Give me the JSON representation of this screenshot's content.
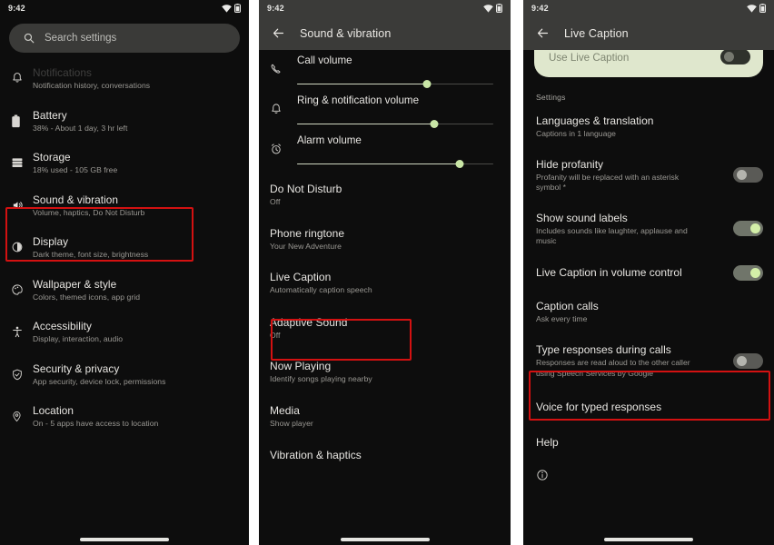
{
  "status_bar": {
    "time": "9:42",
    "wifi_icon": "wifi-icon",
    "battery_icon": "battery-icon"
  },
  "panel1": {
    "search": {
      "placeholder": "Search settings",
      "icon": "search-icon"
    },
    "items": [
      {
        "icon": "bell-icon",
        "title": "Notifications",
        "subtitle": "Notification history, conversations"
      },
      {
        "icon": "battery-icon",
        "title": "Battery",
        "subtitle": "38% - About 1 day, 3 hr left"
      },
      {
        "icon": "storage-icon",
        "title": "Storage",
        "subtitle": "18% used - 105 GB free"
      },
      {
        "icon": "volume-icon",
        "title": "Sound & vibration",
        "subtitle": "Volume, haptics, Do Not Disturb"
      },
      {
        "icon": "brightness-icon",
        "title": "Display",
        "subtitle": "Dark theme, font size, brightness"
      },
      {
        "icon": "palette-icon",
        "title": "Wallpaper & style",
        "subtitle": "Colors, themed icons, app grid"
      },
      {
        "icon": "accessibility-icon",
        "title": "Accessibility",
        "subtitle": "Display, interaction, audio"
      },
      {
        "icon": "shield-icon",
        "title": "Security & privacy",
        "subtitle": "App security, device lock, permissions"
      },
      {
        "icon": "location-pin-icon",
        "title": "Location",
        "subtitle": "On - 5 apps have access to location"
      }
    ]
  },
  "panel2": {
    "appbar": {
      "back_icon": "back-arrow-icon",
      "title": "Sound & vibration"
    },
    "sliders": [
      {
        "icon": "phone-icon",
        "label": "Call volume",
        "value": 66
      },
      {
        "icon": "bell-icon",
        "label": "Ring & notification volume",
        "value": 70
      },
      {
        "icon": "alarm-icon",
        "label": "Alarm volume",
        "value": 83
      }
    ],
    "items": [
      {
        "title": "Do Not Disturb",
        "subtitle": "Off"
      },
      {
        "title": "Phone ringtone",
        "subtitle": "Your New Adventure"
      },
      {
        "title": "Live Caption",
        "subtitle": "Automatically caption speech"
      },
      {
        "title": "Adaptive Sound",
        "subtitle": "Off"
      },
      {
        "title": "Now Playing",
        "subtitle": "Identify songs playing nearby"
      },
      {
        "title": "Media",
        "subtitle": "Show player"
      },
      {
        "title": "Vibration & haptics",
        "subtitle": ""
      }
    ]
  },
  "panel3": {
    "appbar": {
      "back_icon": "back-arrow-icon",
      "title": "Live Caption"
    },
    "use_live_caption": {
      "title": "Use Live Caption",
      "state": "off"
    },
    "section_label": "Settings",
    "items": [
      {
        "title": "Languages & translation",
        "subtitle": "Captions in 1 language",
        "toggle": null
      },
      {
        "title": "Hide profanity",
        "subtitle": "Profanity will be replaced with an asterisk symbol *",
        "toggle": "off"
      },
      {
        "title": "Show sound labels",
        "subtitle": "Includes sounds like laughter, applause and music",
        "toggle": "on"
      },
      {
        "title": "Live Caption in volume control",
        "subtitle": "",
        "toggle": "on"
      },
      {
        "title": "Caption calls",
        "subtitle": "Ask every time",
        "toggle": null
      },
      {
        "title": "Type responses during calls",
        "subtitle": "Responses are read aloud to the other caller using Speech Services by Google",
        "toggle": "off"
      },
      {
        "title": "Voice for typed responses",
        "subtitle": "",
        "toggle": null
      },
      {
        "title": "Help",
        "subtitle": "",
        "toggle": null
      }
    ],
    "info_icon": "info-icon"
  },
  "annotations": {
    "highlight_color": "#d31111",
    "boxes": [
      {
        "target": "Sound & vibration"
      },
      {
        "target": "Live Caption"
      },
      {
        "target": "Type responses during calls"
      }
    ]
  }
}
